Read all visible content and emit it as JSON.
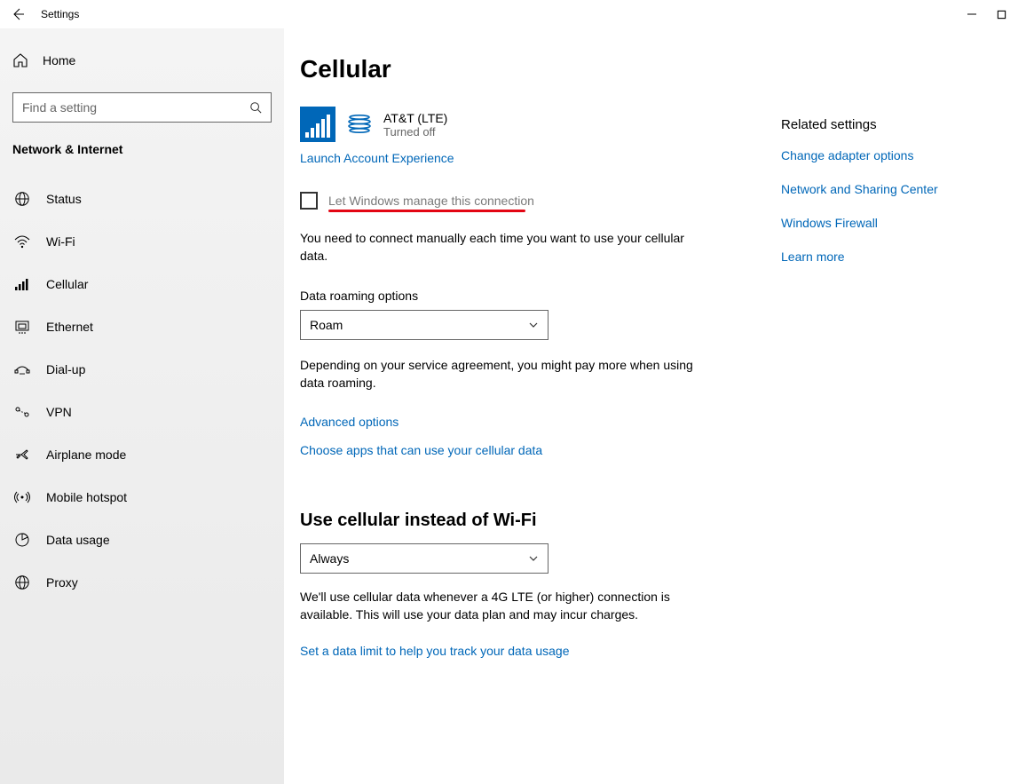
{
  "titlebar": {
    "title": "Settings"
  },
  "sidebar": {
    "home_label": "Home",
    "search_placeholder": "Find a setting",
    "section_label": "Network & Internet",
    "items": [
      {
        "icon": "status-icon",
        "label": "Status"
      },
      {
        "icon": "wifi-icon",
        "label": "Wi-Fi"
      },
      {
        "icon": "cellular-icon",
        "label": "Cellular"
      },
      {
        "icon": "ethernet-icon",
        "label": "Ethernet"
      },
      {
        "icon": "dialup-icon",
        "label": "Dial-up"
      },
      {
        "icon": "vpn-icon",
        "label": "VPN"
      },
      {
        "icon": "airplane-icon",
        "label": "Airplane mode"
      },
      {
        "icon": "hotspot-icon",
        "label": "Mobile hotspot"
      },
      {
        "icon": "datausage-icon",
        "label": "Data usage"
      },
      {
        "icon": "proxy-icon",
        "label": "Proxy"
      }
    ]
  },
  "page": {
    "title": "Cellular",
    "network_name": "AT&T (LTE)",
    "network_state": "Turned off",
    "launch_link": "Launch Account Experience",
    "checkbox_label": "Let Windows manage this connection",
    "checkbox_help": "You need to connect manually each time you want to use your cellular data.",
    "roaming_label": "Data roaming options",
    "roaming_value": "Roam",
    "roaming_help": "Depending on your service agreement, you might pay more when using data roaming.",
    "advanced_link": "Advanced options",
    "choose_apps_link": "Choose apps that can use your cellular data",
    "instead_heading": "Use cellular instead of Wi-Fi",
    "instead_value": "Always",
    "instead_help": "We'll use cellular data whenever a 4G LTE (or higher) connection is available. This will use your data plan and may incur charges.",
    "data_limit_link": "Set a data limit to help you track your data usage"
  },
  "related": {
    "heading": "Related settings",
    "links": [
      "Change adapter options",
      "Network and Sharing Center",
      "Windows Firewall",
      "Learn more"
    ]
  }
}
